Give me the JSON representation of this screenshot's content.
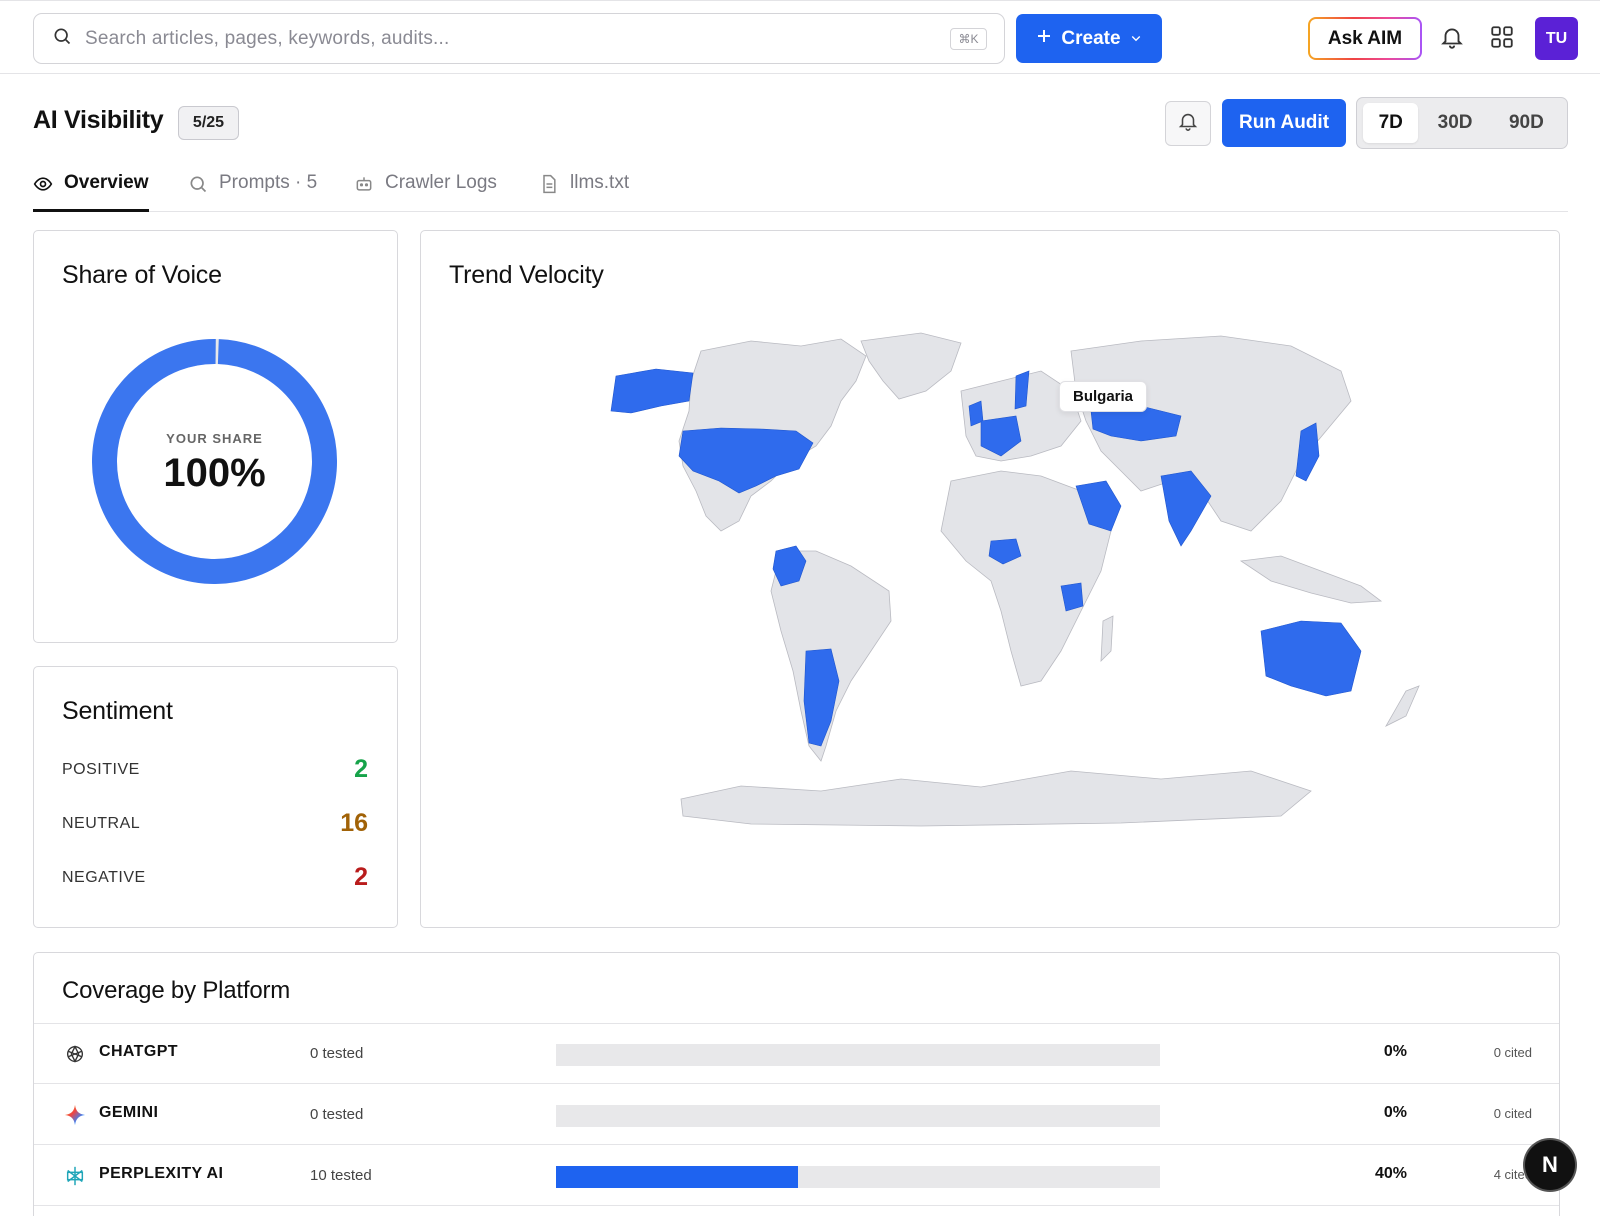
{
  "topbar": {
    "search_placeholder": "Search articles, pages, keywords, audits...",
    "shortcut": "⌘K",
    "create_label": "Create",
    "ask_label": "Ask AIM",
    "avatar_initials": "TU"
  },
  "header": {
    "title": "AI Visibility",
    "count_badge": "5/25",
    "run_audit_label": "Run Audit",
    "ranges": [
      "7D",
      "30D",
      "90D"
    ],
    "active_range": "7D"
  },
  "tabs": {
    "overview": "Overview",
    "prompts": "Prompts · 5",
    "crawler_logs": "Crawler Logs",
    "llms": "llms.txt"
  },
  "share_of_voice": {
    "title": "Share of Voice",
    "label": "YOUR SHARE",
    "value": "100%",
    "share_fraction": 1.0,
    "color": "#3b76ef"
  },
  "sentiment": {
    "title": "Sentiment",
    "rows": [
      {
        "label": "POSITIVE",
        "value": "2",
        "color": "#16a34a"
      },
      {
        "label": "NEUTRAL",
        "value": "16",
        "color": "#a16207"
      },
      {
        "label": "NEGATIVE",
        "value": "2",
        "color": "#b91c1c"
      }
    ]
  },
  "trend_velocity": {
    "title": "Trend Velocity",
    "tooltip": "Bulgaria",
    "highlight_color": "#2f6bed",
    "base_color": "#e3e4e8"
  },
  "coverage": {
    "title": "Coverage by Platform",
    "rows": [
      {
        "name": "CHATGPT",
        "tested": "0 tested",
        "pct_label": "0%",
        "pct": 0,
        "cited": "0 cited",
        "icon": "chatgpt-icon"
      },
      {
        "name": "GEMINI",
        "tested": "0 tested",
        "pct_label": "0%",
        "pct": 0,
        "cited": "0 cited",
        "icon": "gemini-icon"
      },
      {
        "name": "PERPLEXITY AI",
        "tested": "10 tested",
        "pct_label": "40%",
        "pct": 40,
        "cited": "4 cited",
        "icon": "perplexity-icon"
      }
    ]
  },
  "fab_label": "N"
}
